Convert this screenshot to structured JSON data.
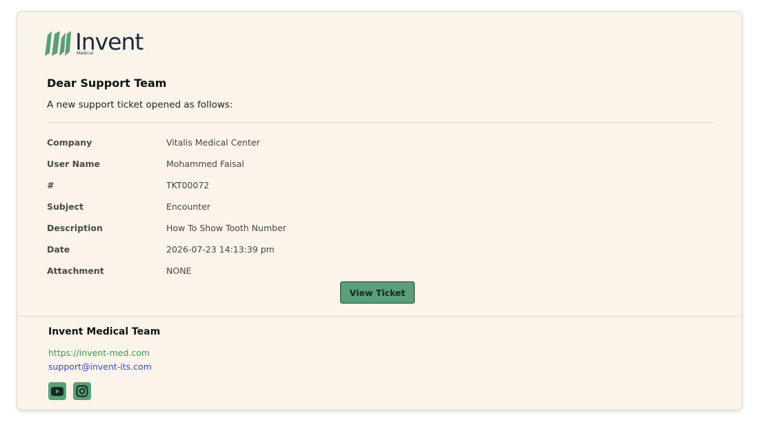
{
  "brand": {
    "name": "Invent",
    "sub": "Medical",
    "accent": "#5a9e7a"
  },
  "email": {
    "greeting": "Dear Support Team",
    "intro": "A new support ticket opened as follows:"
  },
  "ticket": {
    "rows": [
      {
        "label": "Company",
        "value": "Vitalis Medical Center"
      },
      {
        "label": "User Name",
        "value": "Mohammed Faisal"
      },
      {
        "label": "#",
        "value": "TKT00072"
      },
      {
        "label": "Subject",
        "value": "Encounter"
      },
      {
        "label": "Description",
        "value": "How To Show Tooth Number"
      },
      {
        "label": "Date",
        "value": "2026-07-23 14:13:39 pm"
      },
      {
        "label": "Attachment",
        "value": "NONE"
      }
    ]
  },
  "actions": {
    "view_ticket_label": "View Ticket"
  },
  "footer": {
    "team": "Invent Medical Team",
    "website": "https://invent-med.com",
    "email": "support@invent-its.com",
    "social": [
      {
        "icon": "youtube-icon"
      },
      {
        "icon": "instagram-icon"
      }
    ]
  }
}
